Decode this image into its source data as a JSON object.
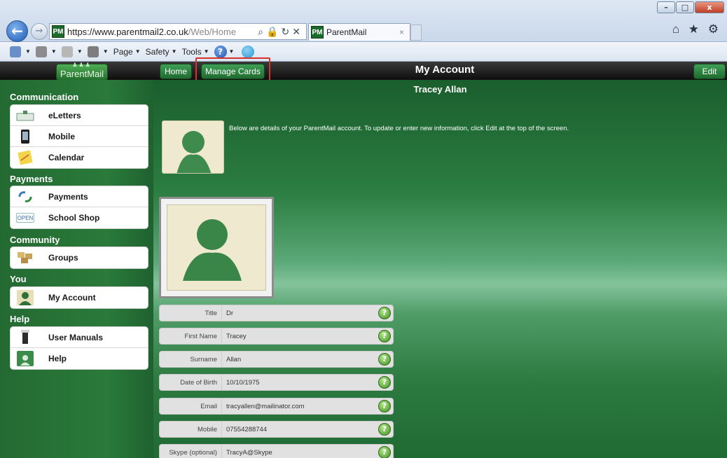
{
  "browser": {
    "address_main": "https://www.parentmail2.co.uk",
    "address_path": "/Web/Home",
    "favicon_text": "PM",
    "tab_title": "ParentMail",
    "tab_close": "×",
    "back_glyph": "←",
    "forward_glyph": "→",
    "window_controls": {
      "minimize": "–",
      "maximize": "□",
      "close": "x"
    },
    "right_icons": "⌂ ★ ⚙",
    "command_bar": {
      "page": "Page",
      "safety": "Safety",
      "tools": "Tools",
      "help_glyph": "?"
    }
  },
  "app": {
    "logo_text": "ParentMail",
    "logo_figures": "♟♟♟",
    "home_button": "Home",
    "manage_cards_button": "Manage Cards",
    "page_title": "My Account",
    "edit_button": "Edit"
  },
  "sidebar": {
    "sections": [
      {
        "title": "Communication",
        "items": [
          {
            "label": "eLetters",
            "icon": "eletters-icon"
          },
          {
            "label": "Mobile",
            "icon": "mobile-icon"
          },
          {
            "label": "Calendar",
            "icon": "calendar-icon"
          }
        ]
      },
      {
        "title": "Payments",
        "items": [
          {
            "label": "Payments",
            "icon": "payments-icon"
          },
          {
            "label": "School Shop",
            "icon": "school-shop-icon"
          }
        ]
      },
      {
        "title": "Community",
        "items": [
          {
            "label": "Groups",
            "icon": "groups-icon"
          }
        ]
      },
      {
        "title": "You",
        "items": [
          {
            "label": "My Account",
            "icon": "my-account-icon"
          }
        ]
      },
      {
        "title": "Help",
        "items": [
          {
            "label": "User Manuals",
            "icon": "user-manuals-icon"
          },
          {
            "label": "Help",
            "icon": "help-icon"
          }
        ]
      }
    ],
    "shop_icon_text": "OPEN"
  },
  "main": {
    "user_name": "Tracey Allan",
    "intro": "Below are details of your ParentMail account. To update or enter new information, click Edit at the top of the screen.",
    "help_glyph": "?",
    "fields": [
      {
        "label": "Title",
        "value": "Dr"
      },
      {
        "label": "First Name",
        "value": "Tracey"
      },
      {
        "label": "Surname",
        "value": "Allan"
      },
      {
        "label": "Date of Birth",
        "value": "10/10/1975"
      },
      {
        "label": "Email",
        "value": "tracyallen@mailinator.com"
      },
      {
        "label": "Mobile",
        "value": "07554288744"
      },
      {
        "label": "Skype (optional)",
        "value": "TracyA@Skype"
      }
    ]
  },
  "colors": {
    "brand_green": "#2a7a3a",
    "header_black": "#0e0e0e",
    "highlight_red": "#d8332b",
    "help_green": "#3f8f21"
  }
}
